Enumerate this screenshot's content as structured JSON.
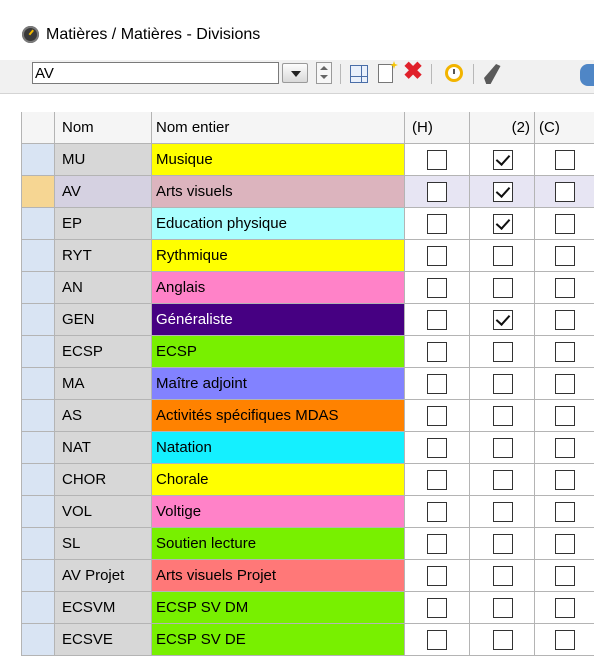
{
  "window": {
    "title": "Matières / Matières - Divisions"
  },
  "toolbar": {
    "filter_value": "AV",
    "icons": [
      "dropdown-icon",
      "spinner-icon",
      "grid-icon",
      "new-icon",
      "delete-icon",
      "clock-icon",
      "edit-icon",
      "refresh-icon"
    ]
  },
  "table": {
    "headers": {
      "code": "Nom",
      "name": "Nom entier",
      "h": "(H)",
      "two": "(2)",
      "c": "(C)"
    },
    "rows": [
      {
        "code": "MU",
        "name": "Musique",
        "color": "#ffff00",
        "text_color": "#000000",
        "h": false,
        "two": true,
        "c": false
      },
      {
        "code": "AV",
        "name": "Arts visuels",
        "color": "#dcb4be",
        "text_color": "#000000",
        "h": false,
        "two": true,
        "c": false,
        "current": true
      },
      {
        "code": "EP",
        "name": "Education physique",
        "color": "#aaffff",
        "text_color": "#000000",
        "h": false,
        "two": true,
        "c": false
      },
      {
        "code": "RYT",
        "name": "Rythmique",
        "color": "#ffff00",
        "text_color": "#000000",
        "h": false,
        "two": false,
        "c": false
      },
      {
        "code": "AN",
        "name": "Anglais",
        "color": "#ff82c8",
        "text_color": "#000000",
        "h": false,
        "two": false,
        "c": false
      },
      {
        "code": "GEN",
        "name": "Généraliste",
        "color": "#460082",
        "text_color": "#ffffff",
        "h": false,
        "two": true,
        "c": false
      },
      {
        "code": "ECSP",
        "name": "ECSP",
        "color": "#78f000",
        "text_color": "#000000",
        "h": false,
        "two": false,
        "c": false
      },
      {
        "code": "MA",
        "name": "Maître adjoint",
        "color": "#8282ff",
        "text_color": "#000000",
        "h": false,
        "two": false,
        "c": false
      },
      {
        "code": "AS",
        "name": "Activités spécifiques MDAS",
        "color": "#ff8200",
        "text_color": "#000000",
        "h": false,
        "two": false,
        "c": false
      },
      {
        "code": "NAT",
        "name": "Natation",
        "color": "#14f0ff",
        "text_color": "#000000",
        "h": false,
        "two": false,
        "c": false
      },
      {
        "code": "CHOR",
        "name": "Chorale",
        "color": "#ffff00",
        "text_color": "#000000",
        "h": false,
        "two": false,
        "c": false
      },
      {
        "code": "VOL",
        "name": "Voltige",
        "color": "#ff82c8",
        "text_color": "#000000",
        "h": false,
        "two": false,
        "c": false
      },
      {
        "code": "SL",
        "name": "Soutien lecture",
        "color": "#78f000",
        "text_color": "#000000",
        "h": false,
        "two": false,
        "c": false
      },
      {
        "code": "AV Projet",
        "name": "Arts visuels Projet",
        "color": "#ff7878",
        "text_color": "#000000",
        "h": false,
        "two": false,
        "c": false
      },
      {
        "code": "ECSVM",
        "name": "ECSP SV DM",
        "color": "#78f000",
        "text_color": "#000000",
        "h": false,
        "two": false,
        "c": false
      },
      {
        "code": "ECSVE",
        "name": "ECSP SV DE",
        "color": "#78f000",
        "text_color": "#000000",
        "h": false,
        "two": false,
        "c": false
      }
    ]
  }
}
